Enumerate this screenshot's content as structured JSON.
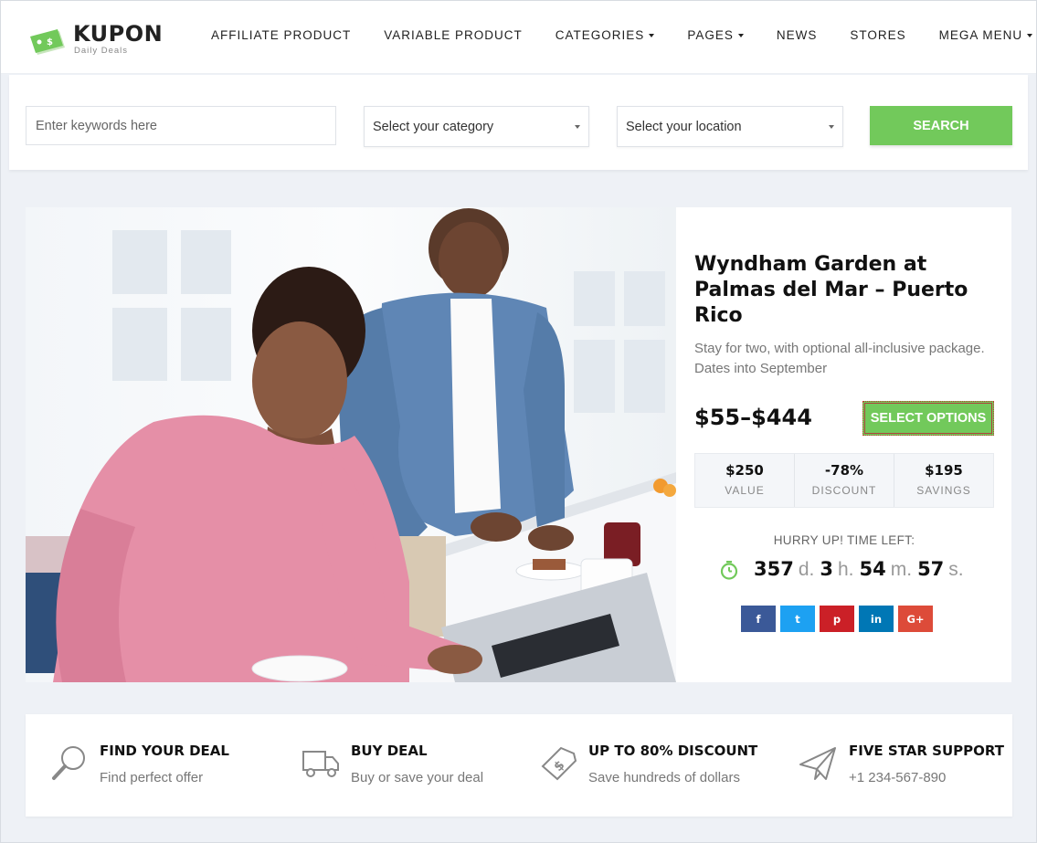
{
  "brand": {
    "name": "KUPON",
    "tagline": "Daily Deals",
    "accent": "#72c95b"
  },
  "nav": [
    {
      "label": "AFFILIATE PRODUCT",
      "dropdown": false
    },
    {
      "label": "VARIABLE PRODUCT",
      "dropdown": false
    },
    {
      "label": "CATEGORIES",
      "dropdown": true
    },
    {
      "label": "PAGES",
      "dropdown": true
    },
    {
      "label": "NEWS",
      "dropdown": false
    },
    {
      "label": "STORES",
      "dropdown": false
    },
    {
      "label": "MEGA MENU",
      "dropdown": true
    }
  ],
  "search": {
    "keyword_placeholder": "Enter keywords here",
    "category_selected": "Select your category",
    "location_selected": "Select your location",
    "button_label": "SEARCH"
  },
  "deal": {
    "title": "Wyndham Garden at Palmas del Mar – Puerto Rico",
    "description": "Stay for two, with optional all-inclusive package. Dates into September",
    "price": "$55–$444",
    "select_label": "SELECT OPTIONS",
    "stats": [
      {
        "value": "$250",
        "label": "VALUE"
      },
      {
        "value": "-78%",
        "label": "DISCOUNT"
      },
      {
        "value": "$195",
        "label": "SAVINGS"
      }
    ],
    "hurry_label": "HURRY UP! TIME LEFT:",
    "countdown": {
      "days": "357",
      "days_unit": "d.",
      "hours": "3",
      "hours_unit": "h.",
      "minutes": "54",
      "minutes_unit": "m.",
      "seconds": "57",
      "seconds_unit": "s."
    },
    "social": [
      {
        "name": "facebook-icon",
        "glyph": "f",
        "color": "#3b5998"
      },
      {
        "name": "twitter-icon",
        "glyph": "t",
        "color": "#1da1f2"
      },
      {
        "name": "pinterest-icon",
        "glyph": "p",
        "color": "#cb2027"
      },
      {
        "name": "linkedin-icon",
        "glyph": "in",
        "color": "#0077b5"
      },
      {
        "name": "google-plus-icon",
        "glyph": "G+",
        "color": "#dd4b39"
      }
    ]
  },
  "features": [
    {
      "icon": "magnifier-icon",
      "title": "FIND YOUR DEAL",
      "subtitle": "Find perfect offer"
    },
    {
      "icon": "delivery-truck-icon",
      "title": "BUY DEAL",
      "subtitle": "Buy or save your deal"
    },
    {
      "icon": "dollar-tag-icon",
      "title": "UP TO 80% DISCOUNT",
      "subtitle": "Save hundreds of dollars"
    },
    {
      "icon": "paper-plane-icon",
      "title": "FIVE STAR SUPPORT",
      "subtitle": "+1 234-567-890"
    }
  ]
}
